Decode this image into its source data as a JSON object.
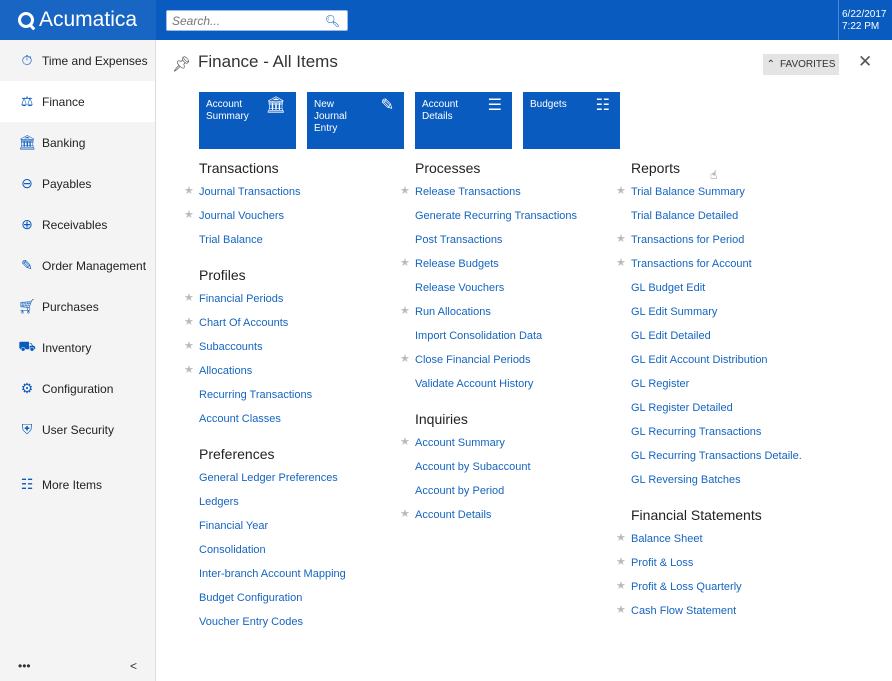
{
  "app": {
    "name": "Acumatica"
  },
  "search": {
    "placeholder": "Search..."
  },
  "datetime": {
    "date": "6/22/2017",
    "time": "7:22 PM"
  },
  "sidebar": {
    "items": [
      {
        "label": "Time and Expenses",
        "icon": "stopwatch-icon"
      },
      {
        "label": "Finance",
        "icon": "scales-icon"
      },
      {
        "label": "Banking",
        "icon": "bank-icon"
      },
      {
        "label": "Payables",
        "icon": "minus-circle-icon"
      },
      {
        "label": "Receivables",
        "icon": "plus-circle-icon"
      },
      {
        "label": "Order Management",
        "icon": "edit-icon"
      },
      {
        "label": "Purchases",
        "icon": "cart-icon"
      },
      {
        "label": "Inventory",
        "icon": "truck-icon"
      },
      {
        "label": "Configuration",
        "icon": "gear-icon"
      },
      {
        "label": "User Security",
        "icon": "shield-icon"
      }
    ],
    "more": "More Items",
    "footer_dots": "•••",
    "collapse": "<"
  },
  "page": {
    "title": "Finance - All Items",
    "favorites": "FAVORITES",
    "accent": "#0a5bbf"
  },
  "tiles": [
    {
      "label": "Account Summary",
      "icon": "bank-icon"
    },
    {
      "label": "New Journal Entry",
      "icon": "edit-icon"
    },
    {
      "label": "Account Details",
      "icon": "list-icon"
    },
    {
      "label": "Budgets",
      "icon": "server-icon"
    }
  ],
  "col1": {
    "transactions": {
      "title": "Transactions",
      "items": [
        {
          "label": "Journal Transactions",
          "star": true
        },
        {
          "label": "Journal Vouchers",
          "star": true
        },
        {
          "label": "Trial Balance",
          "star": false
        }
      ]
    },
    "profiles": {
      "title": "Profiles",
      "items": [
        {
          "label": "Financial Periods",
          "star": true
        },
        {
          "label": "Chart Of Accounts",
          "star": true
        },
        {
          "label": "Subaccounts",
          "star": true
        },
        {
          "label": "Allocations",
          "star": true
        },
        {
          "label": "Recurring Transactions",
          "star": false
        },
        {
          "label": "Account Classes",
          "star": false
        }
      ]
    },
    "preferences": {
      "title": "Preferences",
      "items": [
        {
          "label": "General Ledger Preferences",
          "star": false
        },
        {
          "label": "Ledgers",
          "star": false
        },
        {
          "label": "Financial Year",
          "star": false
        },
        {
          "label": "Consolidation",
          "star": false
        },
        {
          "label": "Inter-branch Account Mapping",
          "star": false
        },
        {
          "label": "Budget Configuration",
          "star": false
        },
        {
          "label": "Voucher Entry Codes",
          "star": false
        }
      ]
    }
  },
  "col2": {
    "processes": {
      "title": "Processes",
      "items": [
        {
          "label": "Release Transactions",
          "star": true
        },
        {
          "label": "Generate Recurring Transactions",
          "star": false
        },
        {
          "label": "Post Transactions",
          "star": false
        },
        {
          "label": "Release Budgets",
          "star": true
        },
        {
          "label": "Release Vouchers",
          "star": false
        },
        {
          "label": "Run Allocations",
          "star": true
        },
        {
          "label": "Import Consolidation Data",
          "star": false
        },
        {
          "label": "Close Financial Periods",
          "star": true
        },
        {
          "label": "Validate Account History",
          "star": false
        }
      ]
    },
    "inquiries": {
      "title": "Inquiries",
      "items": [
        {
          "label": "Account Summary",
          "star": true
        },
        {
          "label": "Account by Subaccount",
          "star": false
        },
        {
          "label": "Account by Period",
          "star": false
        },
        {
          "label": "Account Details",
          "star": true
        }
      ]
    }
  },
  "col3": {
    "reports": {
      "title": "Reports",
      "items": [
        {
          "label": "Trial Balance Summary",
          "star": true
        },
        {
          "label": "Trial Balance Detailed",
          "star": false
        },
        {
          "label": "Transactions for Period",
          "star": true
        },
        {
          "label": "Transactions for Account",
          "star": true
        },
        {
          "label": "GL Budget Edit",
          "star": false
        },
        {
          "label": "GL Edit Summary",
          "star": false
        },
        {
          "label": "GL Edit Detailed",
          "star": false
        },
        {
          "label": "GL Edit Account Distribution",
          "star": false
        },
        {
          "label": "GL Register",
          "star": false
        },
        {
          "label": "GL Register Detailed",
          "star": false
        },
        {
          "label": "GL Recurring Transactions",
          "star": false
        },
        {
          "label": "GL Recurring Transactions Detaile.",
          "star": false
        },
        {
          "label": "GL Reversing Batches",
          "star": false
        }
      ]
    },
    "statements": {
      "title": "Financial Statements",
      "items": [
        {
          "label": "Balance Sheet",
          "star": true
        },
        {
          "label": "Profit & Loss",
          "star": true
        },
        {
          "label": "Profit & Loss Quarterly",
          "star": true
        },
        {
          "label": "Cash Flow Statement",
          "star": true
        }
      ]
    }
  }
}
